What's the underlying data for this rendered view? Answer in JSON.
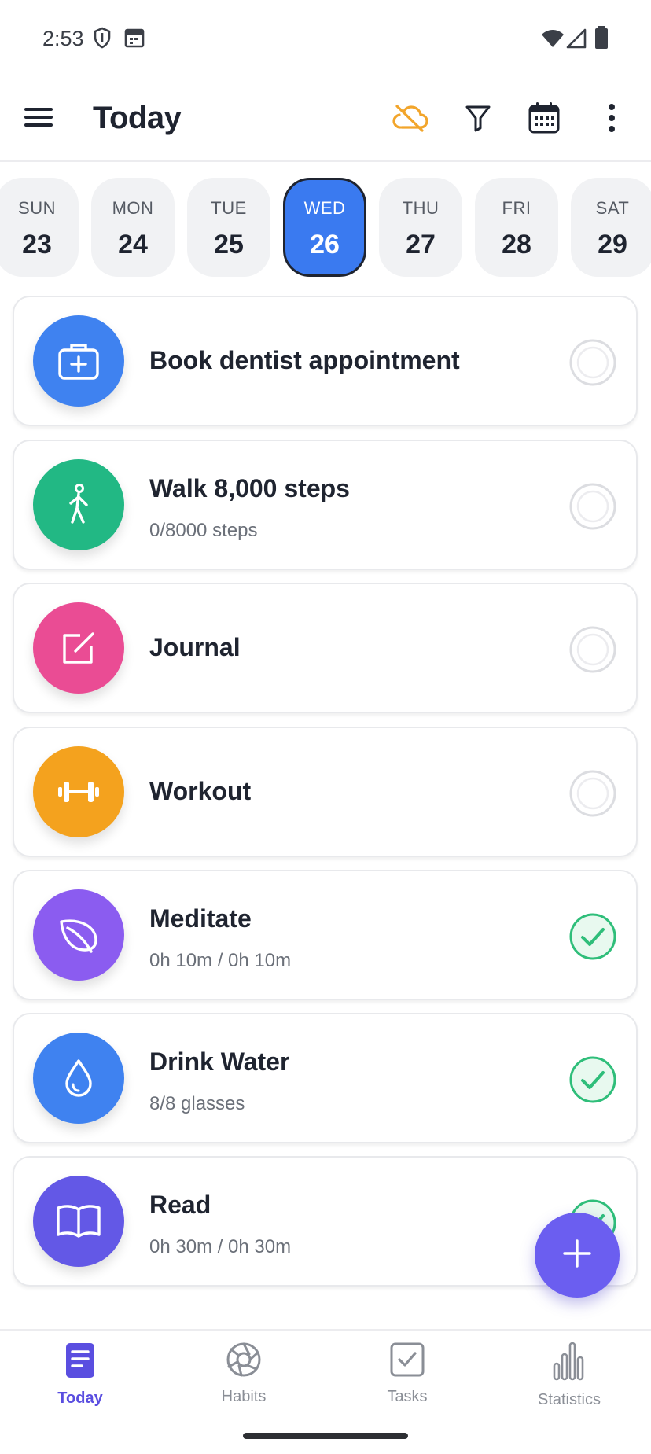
{
  "status_bar": {
    "time": "2:53"
  },
  "app_bar": {
    "title": "Today"
  },
  "colors": {
    "accent": "#3a7af0",
    "fab": "#6b5ef0",
    "sync_warning": "#f2a52b",
    "done": "#2fbe7a"
  },
  "days": [
    {
      "name": "SUN",
      "num": "23",
      "selected": false
    },
    {
      "name": "MON",
      "num": "24",
      "selected": false
    },
    {
      "name": "TUE",
      "num": "25",
      "selected": false
    },
    {
      "name": "WED",
      "num": "26",
      "selected": true
    },
    {
      "name": "THU",
      "num": "27",
      "selected": false
    },
    {
      "name": "FRI",
      "num": "28",
      "selected": false
    },
    {
      "name": "SAT",
      "num": "29",
      "selected": false
    }
  ],
  "habits": [
    {
      "title": "Book dentist appointment",
      "subtitle": "",
      "icon": "medical-kit-icon",
      "color": "#3f82f0",
      "done": false
    },
    {
      "title": "Walk 8,000 steps",
      "subtitle": "0/8000 steps",
      "icon": "walking-person-icon",
      "color": "#22b884",
      "done": false
    },
    {
      "title": "Journal",
      "subtitle": "",
      "icon": "edit-note-icon",
      "color": "#ea4c94",
      "done": false
    },
    {
      "title": "Workout",
      "subtitle": "",
      "icon": "dumbbell-icon",
      "color": "#f4a21e",
      "done": false
    },
    {
      "title": "Meditate",
      "subtitle": "0h 10m / 0h 10m",
      "icon": "leaf-icon",
      "color": "#8b5cf0",
      "done": true
    },
    {
      "title": "Drink Water",
      "subtitle": "8/8 glasses",
      "icon": "water-drop-icon",
      "color": "#3f82f0",
      "done": true
    },
    {
      "title": "Read",
      "subtitle": "0h 30m / 0h 30m",
      "icon": "open-book-icon",
      "color": "#6358e6",
      "done": true
    }
  ],
  "nav": [
    {
      "label": "Today",
      "icon": "today-list-icon",
      "active": true
    },
    {
      "label": "Habits",
      "icon": "habits-aperture-icon",
      "active": false
    },
    {
      "label": "Tasks",
      "icon": "tasks-check-icon",
      "active": false
    },
    {
      "label": "Statistics",
      "icon": "statistics-bars-icon",
      "active": false
    }
  ]
}
